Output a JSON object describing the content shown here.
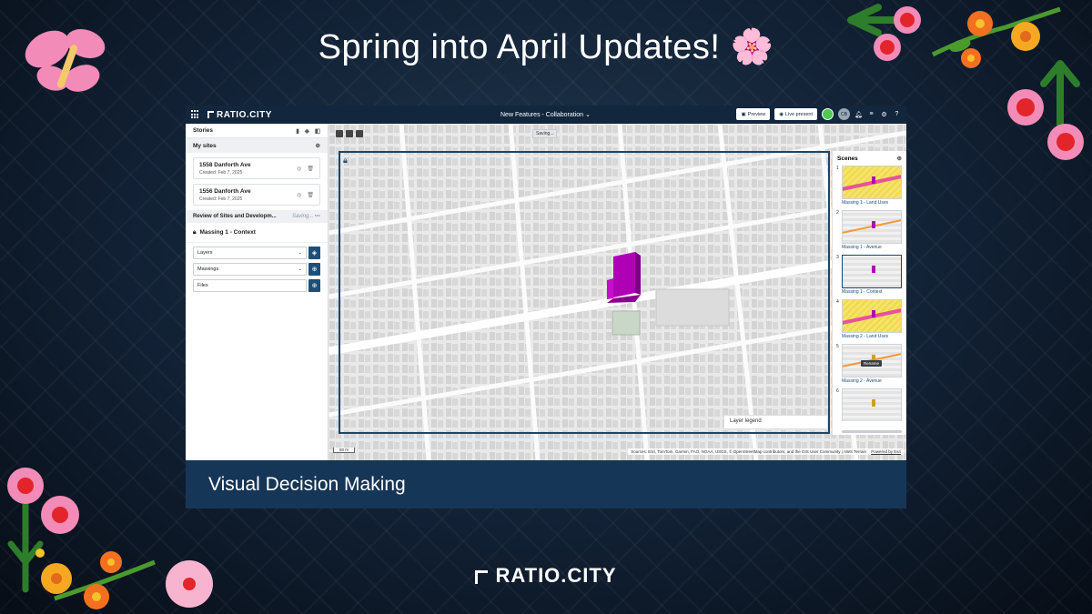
{
  "banner": {
    "title": "Spring into April Updates! 🌸"
  },
  "app": {
    "logo": "RATIO.CITY",
    "project_title": "New Features - Collaboration ⌄",
    "preview_label": "Preview",
    "live_present_label": "Live present",
    "user_initials": "CB"
  },
  "sidebar": {
    "stories_label": "Stories",
    "my_sites_label": "My sites",
    "sites": [
      {
        "name": "1558 Danforth Ave",
        "created": "Created: Feb 7, 2025"
      },
      {
        "name": "1556 Danforth Ave",
        "created": "Created: Feb 7, 2025"
      }
    ],
    "review_label": "Review of Sites and Developm...",
    "review_status": "Saving...",
    "scene_title": "Massing 1 - Context",
    "dropdowns": [
      {
        "label": "Layers"
      },
      {
        "label": "Massings"
      },
      {
        "label": "Files"
      }
    ]
  },
  "map": {
    "saving_label": "Saving...",
    "layer_legend_label": "Layer legend",
    "scale_label": "50 m",
    "attribution": "Sources: Esri, TomTom, Garmin, FAO, NOAA, USGS, © OpenStreetMap contributors, and the GIS User Community | AWS Terrain",
    "powered_by": "Powered by Esri"
  },
  "scenes": {
    "header": "Scenes",
    "tooltip": "Rename",
    "items": [
      {
        "number": "1",
        "label": "Massing 1 - Land Uses",
        "thumb": "yellow-road"
      },
      {
        "number": "2",
        "label": "Massing 1 - Avenue",
        "thumb": "grey-orange"
      },
      {
        "number": "3",
        "label": "Massing 1 - Context",
        "thumb": "grey",
        "selected": true
      },
      {
        "number": "4",
        "label": "Massing 2 - Land Uses",
        "thumb": "yellow-road"
      },
      {
        "number": "5",
        "label": "Massing 2 - Avenue",
        "thumb": "grey-orange"
      },
      {
        "number": "6",
        "label": "",
        "thumb": "grey"
      }
    ]
  },
  "caption": {
    "text": "Visual Decision Making"
  },
  "footer": {
    "brand": "RATIO.CITY"
  },
  "colors": {
    "navy": "#12263d",
    "caption_bg": "#163657",
    "accent_blue": "#1e4f78",
    "massing_magenta": "#b000b6"
  }
}
